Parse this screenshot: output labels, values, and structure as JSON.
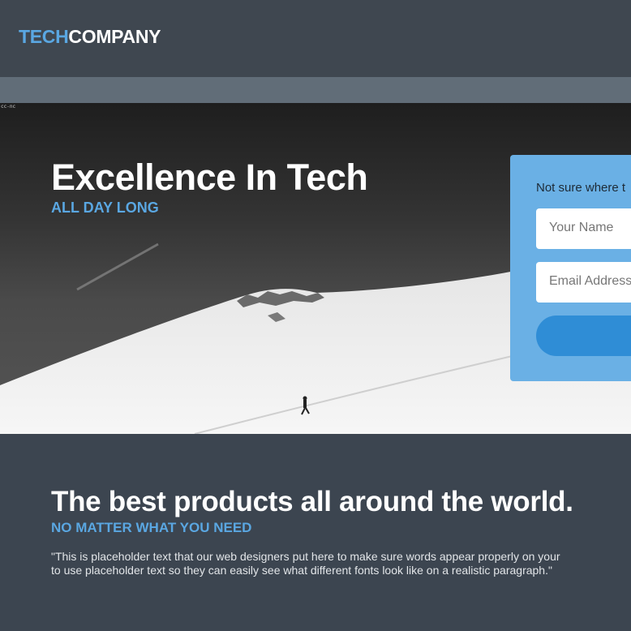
{
  "header": {
    "logo_part1": "TECH",
    "logo_part2": "COMPANY"
  },
  "hero": {
    "license_badge": "cc-nc",
    "title": "Excellence In Tech",
    "subtitle": "ALL DAY LONG"
  },
  "form": {
    "prompt": "Not sure where t",
    "name_placeholder": "Your Name",
    "email_placeholder": "Email Address"
  },
  "section": {
    "title": "The best products all around the world.",
    "subtitle": "NO MATTER WHAT YOU NEED",
    "body_line1": "\"This is placeholder text that our web designers put here to make sure words appear properly on your",
    "body_line2": "to use placeholder text so they can easily see what different fonts look like on a realistic paragraph.\""
  },
  "colors": {
    "accent": "#5aa7e2",
    "header_bg": "#3f4750",
    "nav_bg": "#616d78",
    "form_bg": "#6ab0e5",
    "button_bg": "#2f8dd6"
  }
}
